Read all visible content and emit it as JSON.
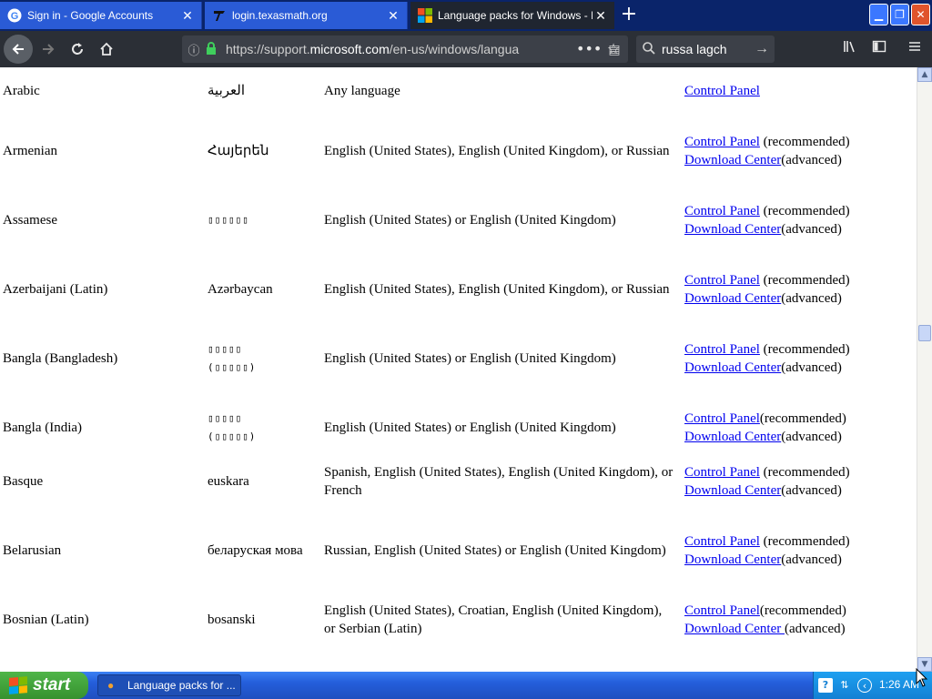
{
  "tabs": [
    {
      "title": "Sign in - Google Accounts",
      "favicon": "google-g-icon",
      "active": false
    },
    {
      "title": "login.texasmath.org",
      "favicon": "texas-logo-icon",
      "active": false
    },
    {
      "title": "Language packs for Windows - Mi",
      "favicon": "microsoft-logo-icon",
      "active": true
    }
  ],
  "toolbar": {
    "url_prefix": "https://support.",
    "url_domain": "microsoft.com",
    "url_suffix": "/en-us/windows/langua",
    "search_value": "russa lagch"
  },
  "rows": [
    {
      "language": "Arabic",
      "native": "العربية",
      "base": "Any language",
      "link1": "Control Panel",
      "suffix1": "",
      "link2": "",
      "suffix2": ""
    },
    {
      "language": "Armenian",
      "native": "Հայերեն",
      "base": "English (United States), English (United Kingdom), or Russian",
      "link1": "Control Panel",
      "suffix1": " (recommended)",
      "link2": "Download Center",
      "suffix2": "(advanced)"
    },
    {
      "language": "Assamese",
      "native": "▯▯▯▯▯▯",
      "base": "English (United States) or English (United Kingdom)",
      "link1": "Control Panel",
      "suffix1": " (recommended)",
      "link2": "Download Center",
      "suffix2": "(advanced)"
    },
    {
      "language": "Azerbaijani (Latin)",
      "native": "Azərbaycan",
      "base": "English (United States), English (United Kingdom), or Russian",
      "link1": "Control Panel",
      "suffix1": " (recommended)",
      "link2": "Download Center",
      "suffix2": "(advanced)"
    },
    {
      "language": "Bangla (Bangladesh)",
      "native": "▯▯▯▯▯",
      "native2": "(▯▯▯▯▯)",
      "base": "English (United States) or English (United Kingdom)",
      "link1": "Control Panel",
      "suffix1": " (recommended)",
      "link2": "Download Center",
      "suffix2": "(advanced)"
    },
    {
      "language": "Bangla (India)",
      "native": "▯▯▯▯▯",
      "native2": "(▯▯▯▯▯)",
      "base": "English (United States) or  English (United Kingdom)",
      "link1": "Control Panel",
      "suffix1": "(recommended)",
      "link2": "Download Center",
      "suffix2": "(advanced)"
    },
    {
      "language": "Basque",
      "native": "euskara",
      "base": "Spanish, English (United States), English (United Kingdom), or French",
      "link1": "Control Panel",
      "suffix1": " (recommended)",
      "link2": "Download Center",
      "suffix2": "(advanced)"
    },
    {
      "language": "Belarusian",
      "native": "беларуская мова",
      "base": "Russian, English (United States) or English (United Kingdom)",
      "link1": "Control Panel",
      "suffix1": " (recommended)",
      "link2": "Download Center",
      "suffix2": "(advanced)"
    },
    {
      "language": "Bosnian (Latin)",
      "native": "bosanski",
      "base": "English (United States), Croatian, English (United Kingdom), or Serbian (Latin)",
      "link1": "Control Panel",
      "suffix1": "(recommended)",
      "link2": "Download Center ",
      "suffix2": "(advanced)"
    }
  ],
  "taskbar": {
    "start_label": "start",
    "task_label": "Language packs for ...",
    "clock": "1:26 AM"
  },
  "colors": {
    "link": "#0000ee",
    "tabstrip": "#0a246a",
    "toolbar": "#2b2f36",
    "taskbar": "#245edb",
    "start": "#36912f"
  }
}
